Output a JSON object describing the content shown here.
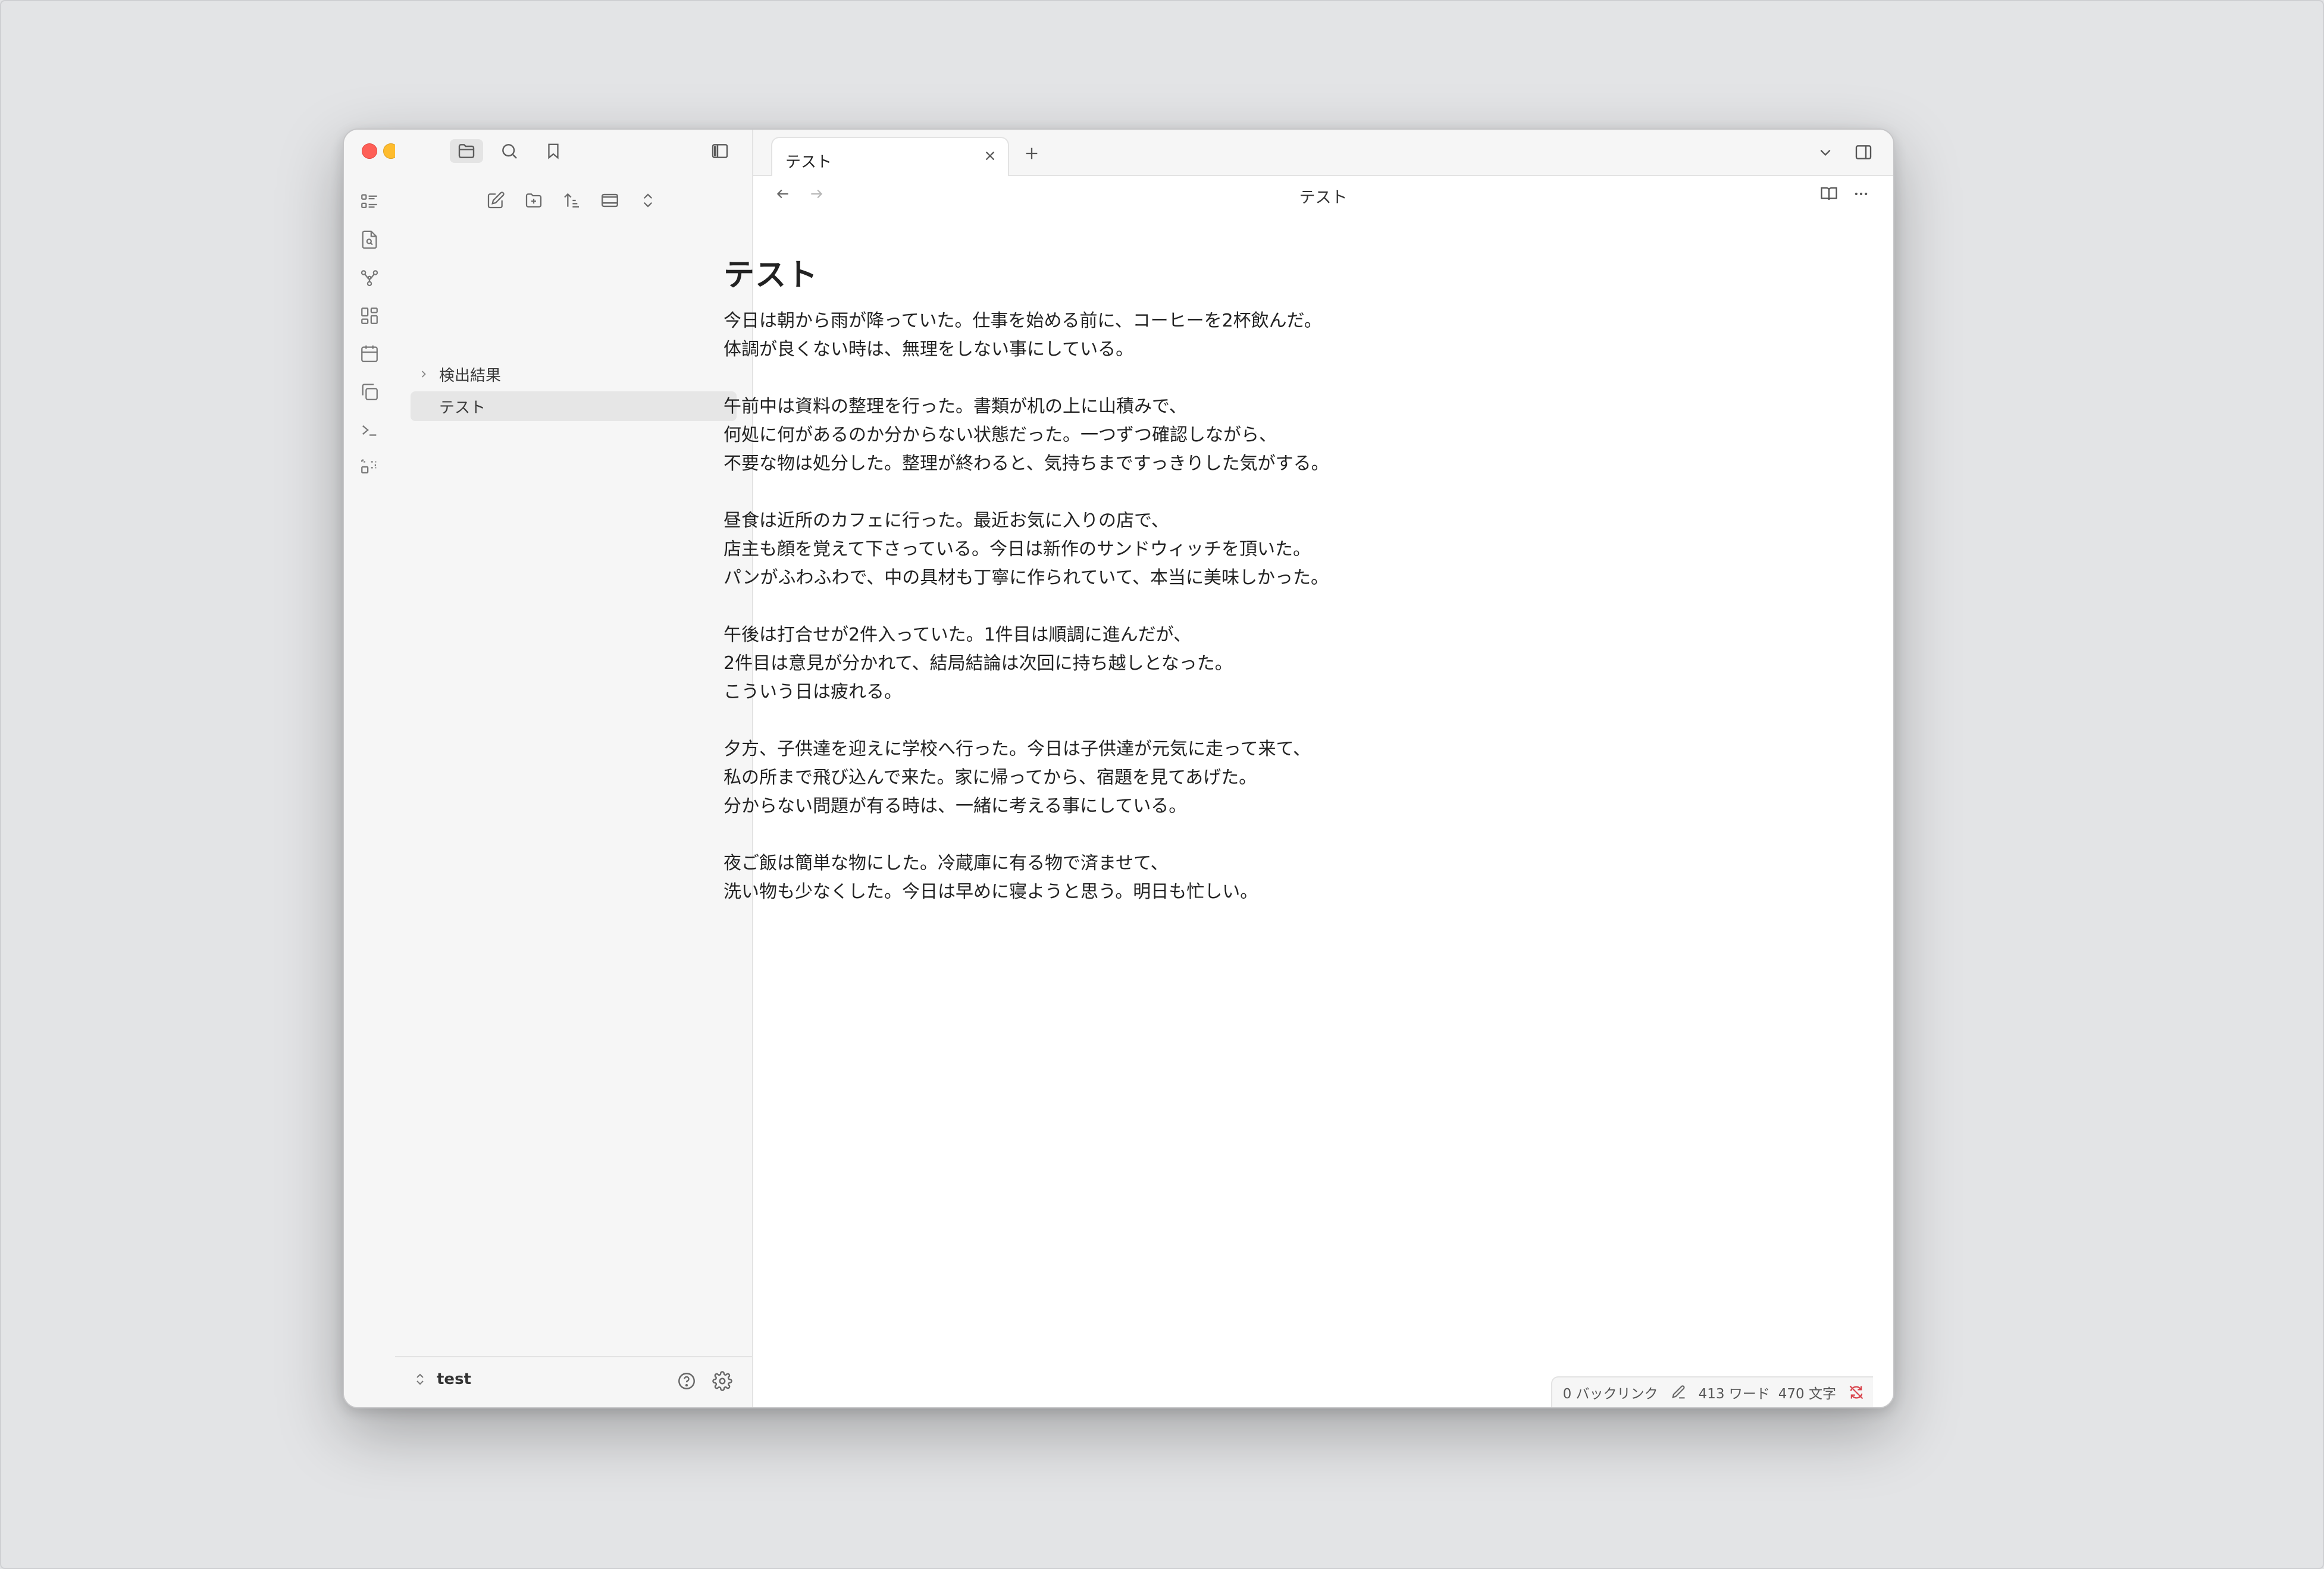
{
  "sidebar": {
    "tree": [
      {
        "label": "検出結果",
        "type": "folder"
      },
      {
        "label": "テスト",
        "type": "file"
      }
    ],
    "vault_name": "test"
  },
  "tabs": [
    {
      "label": "テスト"
    }
  ],
  "view": {
    "title": "テスト"
  },
  "document": {
    "heading": "テスト",
    "paragraphs": [
      [
        "今日は朝から雨が降っていた。仕事を始める前に、コーヒーを2杯飲んだ。",
        "体調が良くない時は、無理をしない事にしている。"
      ],
      [
        "午前中は資料の整理を行った。書類が机の上に山積みで、",
        "何処に何があるのか分からない状態だった。一つずつ確認しながら、",
        "不要な物は処分した。整理が終わると、気持ちまですっきりした気がする。"
      ],
      [
        "昼食は近所のカフェに行った。最近お気に入りの店で、",
        "店主も顔を覚えて下さっている。今日は新作のサンドウィッチを頂いた。",
        "パンがふわふわで、中の具材も丁寧に作られていて、本当に美味しかった。"
      ],
      [
        "午後は打合せが2件入っていた。1件目は順調に進んだが、",
        "2件目は意見が分かれて、結局結論は次回に持ち越しとなった。",
        "こういう日は疲れる。"
      ],
      [
        "夕方、子供達を迎えに学校へ行った。今日は子供達が元気に走って来て、",
        "私の所まで飛び込んで来た。家に帰ってから、宿題を見てあげた。",
        "分からない問題が有る時は、一緒に考える事にしている。"
      ],
      [
        "夜ご飯は簡単な物にした。冷蔵庫に有る物で済ませて、",
        "洗い物も少なくした。今日は早めに寝ようと思う。明日も忙しい。"
      ]
    ]
  },
  "status_bar": {
    "backlinks": "0 バックリンク",
    "words": "413 ワード",
    "chars": "470 文字"
  }
}
